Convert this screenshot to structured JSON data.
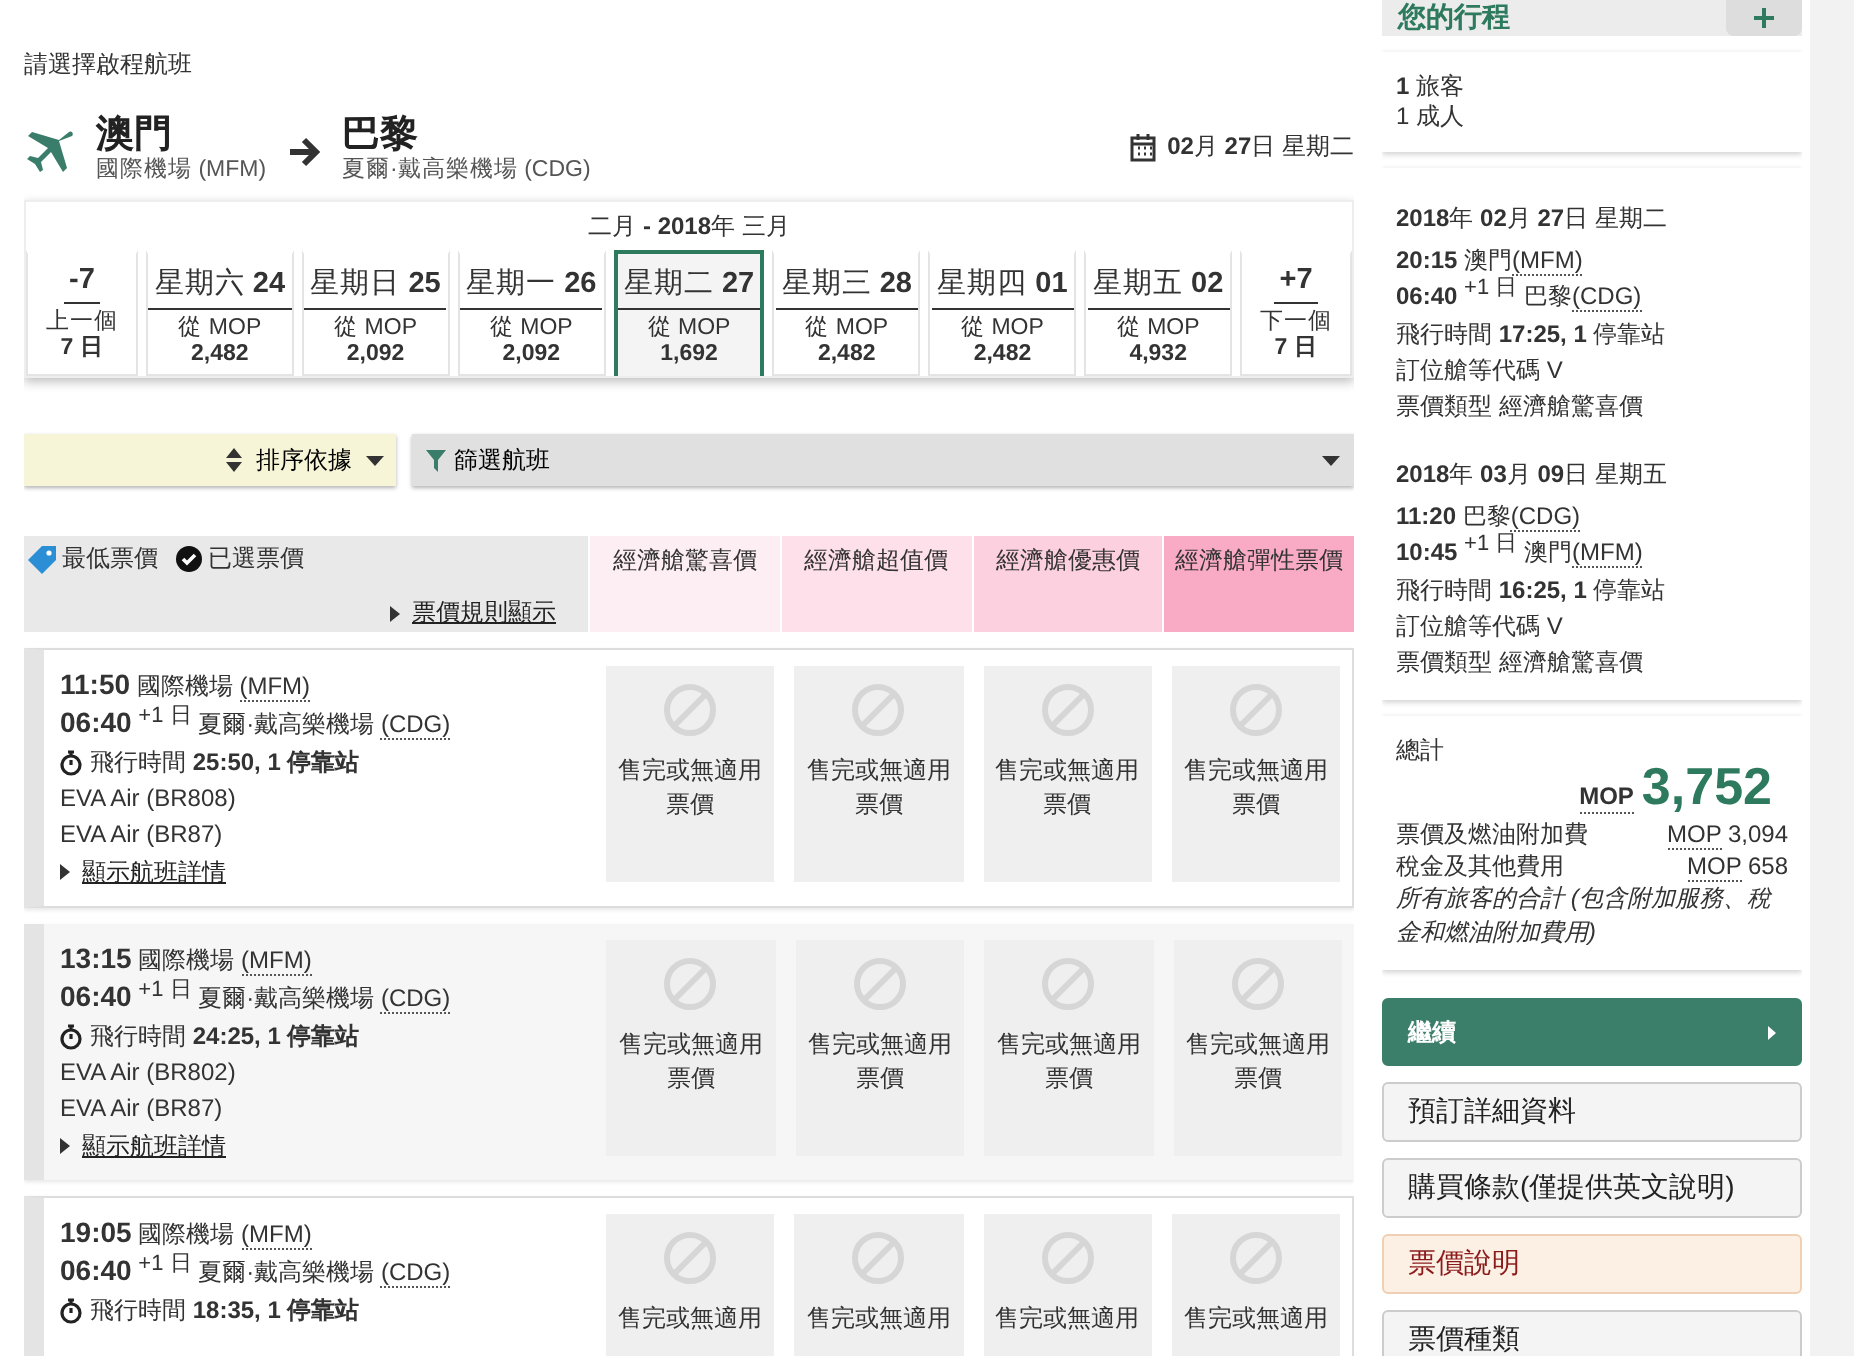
{
  "page_title": "請選擇啟程航班",
  "route": {
    "from_city": "澳門",
    "from_airport": "國際機場 (MFM)",
    "to_city": "巴黎",
    "to_airport": "夏爾·戴高樂機場 (CDG)",
    "date": "**02**月 **27**日 星期二"
  },
  "date_strip": {
    "month_label": "二月 **- 2018**年 三月",
    "days": [
      {
        "kind": "nav",
        "label": "-7",
        "line_1": "上一個",
        "line_2": "7 日"
      },
      {
        "kind": "day",
        "weekday": "星期六",
        "day": "24",
        "from": "從 MOP",
        "price": "2,482",
        "selected": false
      },
      {
        "kind": "day",
        "weekday": "星期日",
        "day": "25",
        "from": "從 MOP",
        "price": "2,092",
        "selected": false
      },
      {
        "kind": "day",
        "weekday": "星期一",
        "day": "26",
        "from": "從 MOP",
        "price": "2,092",
        "selected": false
      },
      {
        "kind": "day",
        "weekday": "星期二",
        "day": "27",
        "from": "從 MOP",
        "price": "1,692",
        "selected": true
      },
      {
        "kind": "day",
        "weekday": "星期三",
        "day": "28",
        "from": "從 MOP",
        "price": "2,482",
        "selected": false
      },
      {
        "kind": "day",
        "weekday": "星期四",
        "day": "01",
        "from": "從 MOP",
        "price": "2,482",
        "selected": false
      },
      {
        "kind": "day",
        "weekday": "星期五",
        "day": "02",
        "from": "從 MOP",
        "price": "4,932",
        "selected": false
      },
      {
        "kind": "nav",
        "label": "+7",
        "line_1": "下一個",
        "line_2": "7 日"
      }
    ]
  },
  "sort": {
    "label": "排序依據"
  },
  "filter": {
    "label": "篩選航班"
  },
  "fare_header": {
    "lowest": "最低票價",
    "chosen": "已選票價",
    "rules_link": "票價規則顯示",
    "classes": [
      {
        "label": "經濟艙驚喜價",
        "color": "#fdeef3"
      },
      {
        "label": "經濟艙超值價",
        "color": "#fde0e9"
      },
      {
        "label": "經濟艙優惠價",
        "color": "#fcd0df"
      },
      {
        "label": "經濟艙彈性票價",
        "color": "#f9abc6"
      }
    ]
  },
  "flights": [
    {
      "depart_time": "11:50",
      "depart_airport": "國際機場",
      "depart_code": "(MFM)",
      "arrive_time": "06:40",
      "day_offset": "+1 日",
      "arrive_airport": "夏爾·戴高樂機場",
      "arrive_code": "(CDG)",
      "duration_label": "飛行時間",
      "duration": "25:50, 1 停靠站",
      "carriers": [
        "EVA Air (BR808)",
        "EVA Air (BR87)"
      ],
      "details_link": "顯示航班詳情",
      "fares": [
        "售完或無適用票價",
        "售完或無適用票價",
        "售完或無適用票價",
        "售完或無適用票價"
      ]
    },
    {
      "depart_time": "13:15",
      "depart_airport": "國際機場",
      "depart_code": "(MFM)",
      "arrive_time": "06:40",
      "day_offset": "+1 日",
      "arrive_airport": "夏爾·戴高樂機場",
      "arrive_code": "(CDG)",
      "duration_label": "飛行時間",
      "duration": "24:25, 1 停靠站",
      "carriers": [
        "EVA Air (BR802)",
        "EVA Air (BR87)"
      ],
      "details_link": "顯示航班詳情",
      "fares": [
        "售完或無適用票價",
        "售完或無適用票價",
        "售完或無適用票價",
        "售完或無適用票價"
      ]
    },
    {
      "depart_time": "19:05",
      "depart_airport": "國際機場",
      "depart_code": "(MFM)",
      "arrive_time": "06:40",
      "day_offset": "+1 日",
      "arrive_airport": "夏爾·戴高樂機場",
      "arrive_code": "(CDG)",
      "duration_label": "飛行時間",
      "duration": "18:35, 1 停靠站",
      "fares": [
        "售完或無適用",
        "售完或無適用",
        "售完或無適用",
        "售完或無適用"
      ]
    }
  ],
  "sidebar": {
    "title": "您的行程",
    "passengers": {
      "count": "**1** 旅客",
      "detail": "1 成人"
    },
    "segments": [
      {
        "date": "**2018**年 **02**月 **27**日 星期二",
        "depart_time": "20:15",
        "depart_place": "澳門",
        "depart_code": "(MFM)",
        "arrive_time": "06:40",
        "day_offset": "+1 日",
        "arrive_place": "巴黎",
        "arrive_code": "(CDG)",
        "duration": "飛行時間 **17:25, 1** 停靠站",
        "booking_class": "訂位艙等代碼 V",
        "fare_type": "票價類型 經濟艙驚喜價"
      },
      {
        "date": "**2018**年 **03**月 **09**日 星期五",
        "depart_time": "11:20",
        "depart_place": "巴黎",
        "depart_code": "(CDG)",
        "arrive_time": "10:45",
        "day_offset": "+1 日",
        "arrive_place": "澳門",
        "arrive_code": "(MFM)",
        "duration": "飛行時間 **16:25, 1** 停靠站",
        "booking_class": "訂位艙等代碼 V",
        "fare_type": "票價類型 經濟艙驚喜價"
      }
    ],
    "total": {
      "label": "總計",
      "currency": "MOP",
      "amount": "3,752",
      "lines": [
        {
          "label": "票價及燃油附加費",
          "currency": "MOP",
          "value": "3,094"
        },
        {
          "label": "稅金及其他費用",
          "currency": "MOP",
          "value": "658"
        }
      ],
      "note": "所有旅客的合計 (包含附加服務、稅金和燃油附加費用)"
    },
    "buttons": [
      {
        "label": "繼續",
        "kind": "primary"
      },
      {
        "label": "預訂詳細資料",
        "kind": "default"
      },
      {
        "label": "購買條款(僅提供英文說明)",
        "kind": "default"
      },
      {
        "label": "票價說明",
        "kind": "highlight"
      },
      {
        "label": "票價種類",
        "kind": "default"
      }
    ]
  }
}
